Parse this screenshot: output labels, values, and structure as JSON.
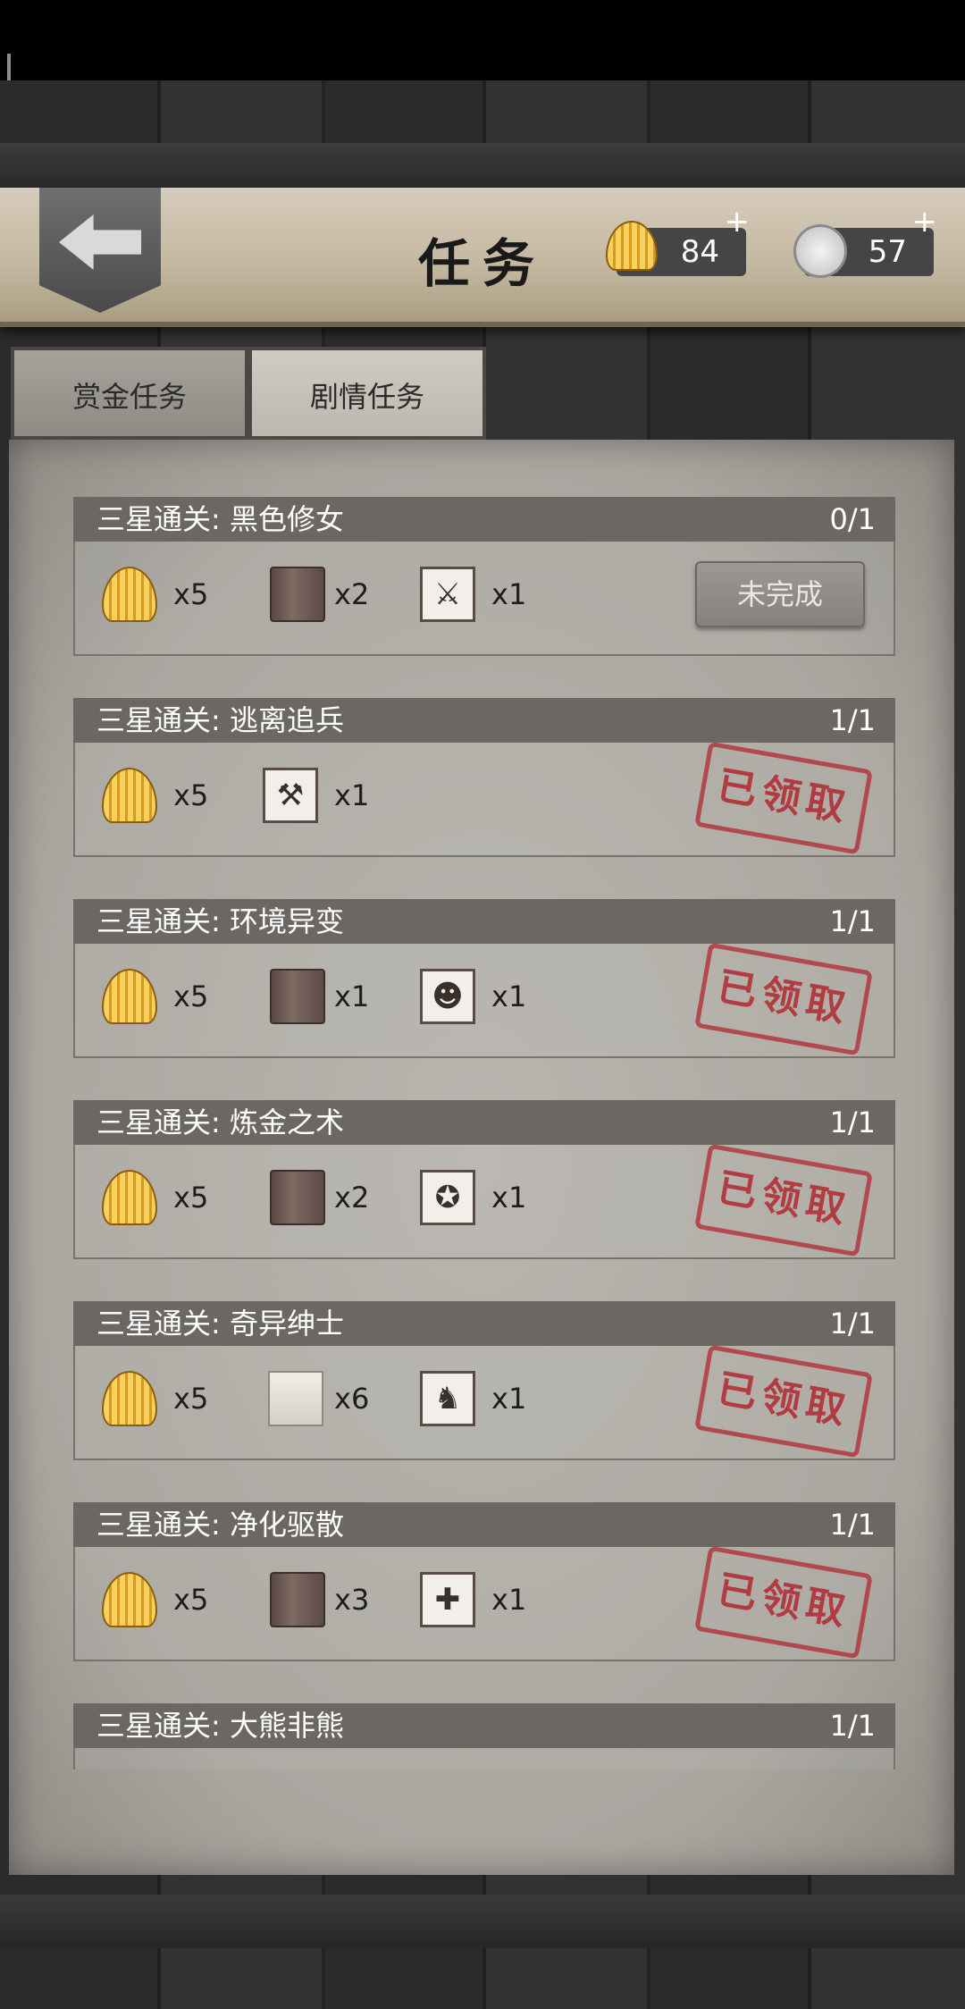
{
  "header": {
    "title": "任务",
    "shells": {
      "value": "84",
      "plus": "+"
    },
    "coins": {
      "value": "57",
      "plus": "+"
    }
  },
  "tabs": [
    {
      "label": "赏金任务",
      "active": false
    },
    {
      "label": "剧情任务",
      "active": true
    }
  ],
  "tasks": [
    {
      "name": "三星通关: 黑色修女",
      "progress": "0/1",
      "status": "button",
      "status_label": "未完成",
      "rewards": [
        {
          "icon": "shell-icon",
          "qty": "x5"
        },
        {
          "icon": "book-icon",
          "qty": "x2"
        },
        {
          "icon": "spear-badge-icon",
          "qty": "x1"
        }
      ]
    },
    {
      "name": "三星通关: 逃离追兵",
      "progress": "1/1",
      "status": "stamp",
      "status_label": "已领取",
      "rewards": [
        {
          "icon": "shell-icon",
          "qty": "x5"
        },
        {
          "icon": "axe-badge-icon",
          "qty": "x1"
        }
      ]
    },
    {
      "name": "三星通关: 环境异变",
      "progress": "1/1",
      "status": "stamp",
      "status_label": "已领取",
      "rewards": [
        {
          "icon": "shell-icon",
          "qty": "x5"
        },
        {
          "icon": "book-icon",
          "qty": "x1"
        },
        {
          "icon": "wolf-badge-icon",
          "qty": "x1"
        }
      ]
    },
    {
      "name": "三星通关: 炼金之术",
      "progress": "1/1",
      "status": "stamp",
      "status_label": "已领取",
      "rewards": [
        {
          "icon": "shell-icon",
          "qty": "x5"
        },
        {
          "icon": "book-icon",
          "qty": "x2"
        },
        {
          "icon": "strongman-badge-icon",
          "qty": "x1"
        }
      ]
    },
    {
      "name": "三星通关: 奇异绅士",
      "progress": "1/1",
      "status": "stamp",
      "status_label": "已领取",
      "rewards": [
        {
          "icon": "shell-icon",
          "qty": "x5"
        },
        {
          "icon": "paper-icon",
          "qty": "x6"
        },
        {
          "icon": "figure-badge-icon",
          "qty": "x1"
        }
      ]
    },
    {
      "name": "三星通关: 净化驱散",
      "progress": "1/1",
      "status": "stamp",
      "status_label": "已领取",
      "rewards": [
        {
          "icon": "shell-icon",
          "qty": "x5"
        },
        {
          "icon": "book-icon",
          "qty": "x3"
        },
        {
          "icon": "bandage-badge-icon",
          "qty": "x1"
        }
      ]
    },
    {
      "name": "三星通关: 大熊非熊",
      "progress": "1/1",
      "status": "stamp",
      "status_label": "",
      "rewards": []
    }
  ]
}
